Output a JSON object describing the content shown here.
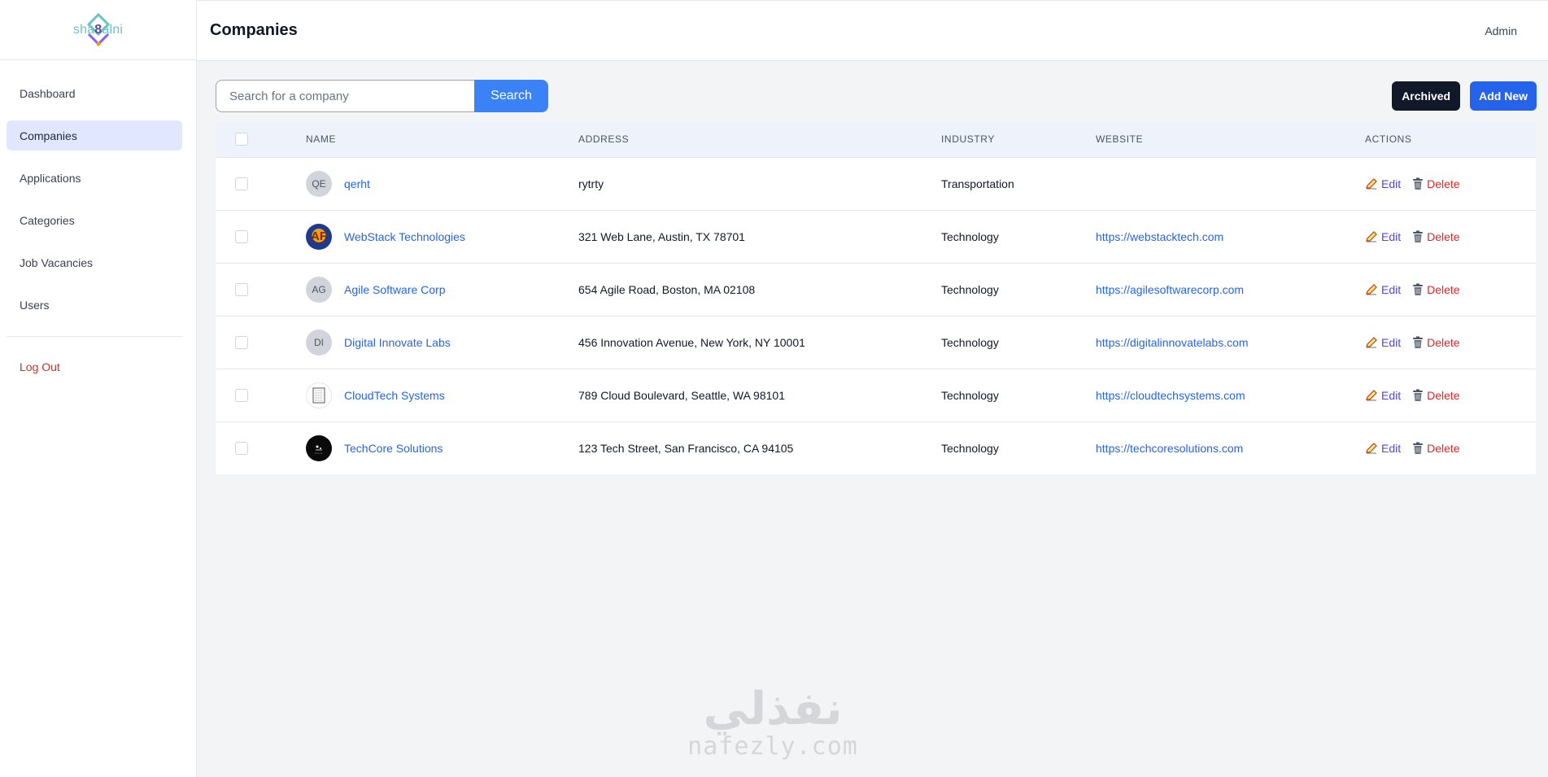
{
  "brand": {
    "logo_text_left": "sha",
    "logo_text_mid": "8",
    "logo_text_right": "alni"
  },
  "sidebar": {
    "items": [
      {
        "label": "Dashboard"
      },
      {
        "label": "Companies",
        "active": true
      },
      {
        "label": "Applications"
      },
      {
        "label": "Categories"
      },
      {
        "label": "Job Vacancies"
      },
      {
        "label": "Users"
      }
    ],
    "logout_label": "Log Out"
  },
  "header": {
    "title": "Companies",
    "user": "Admin"
  },
  "toolbar": {
    "search_placeholder": "Search for a company",
    "search_value": "",
    "search_label": "Search",
    "archived_label": "Archived",
    "add_new_label": "Add New"
  },
  "table": {
    "columns": [
      "Name",
      "Address",
      "Industry",
      "Website",
      "Actions"
    ],
    "edit_label": "Edit",
    "delete_label": "Delete",
    "rows": [
      {
        "initials": "QE",
        "avatar": "initials",
        "name": "qerht",
        "address": "rytrty",
        "industry": "Transportation",
        "website": ""
      },
      {
        "initials": "AF",
        "avatar": "image-af",
        "name": "WebStack Technologies",
        "address": "321 Web Lane, Austin, TX 78701",
        "industry": "Technology",
        "website": "https://webstacktech.com"
      },
      {
        "initials": "AG",
        "avatar": "initials",
        "name": "Agile Software Corp",
        "address": "654 Agile Road, Boston, MA 02108",
        "industry": "Technology",
        "website": "https://agilesoftwarecorp.com"
      },
      {
        "initials": "DI",
        "avatar": "initials",
        "name": "Digital Innovate Labs",
        "address": "456 Innovation Avenue, New York, NY 10001",
        "industry": "Technology",
        "website": "https://digitalinnovatelabs.com"
      },
      {
        "initials": "",
        "avatar": "image-ct",
        "name": "CloudTech Systems",
        "address": "789 Cloud Boulevard, Seattle, WA 98101",
        "industry": "Technology",
        "website": "https://cloudtechsystems.com"
      },
      {
        "initials": "",
        "avatar": "image-tc",
        "name": "TechCore Solutions",
        "address": "123 Tech Street, San Francisco, CA 94105",
        "industry": "Technology",
        "website": "https://techcoresolutions.com"
      }
    ]
  },
  "watermark": {
    "arabic": "نفذلي",
    "latin": "nafezly.com"
  },
  "colors": {
    "primary": "#3b82f6",
    "dark_button": "#111827",
    "danger": "#dc2626",
    "link": "#2563eb",
    "active_nav": "#e0e7ff"
  }
}
